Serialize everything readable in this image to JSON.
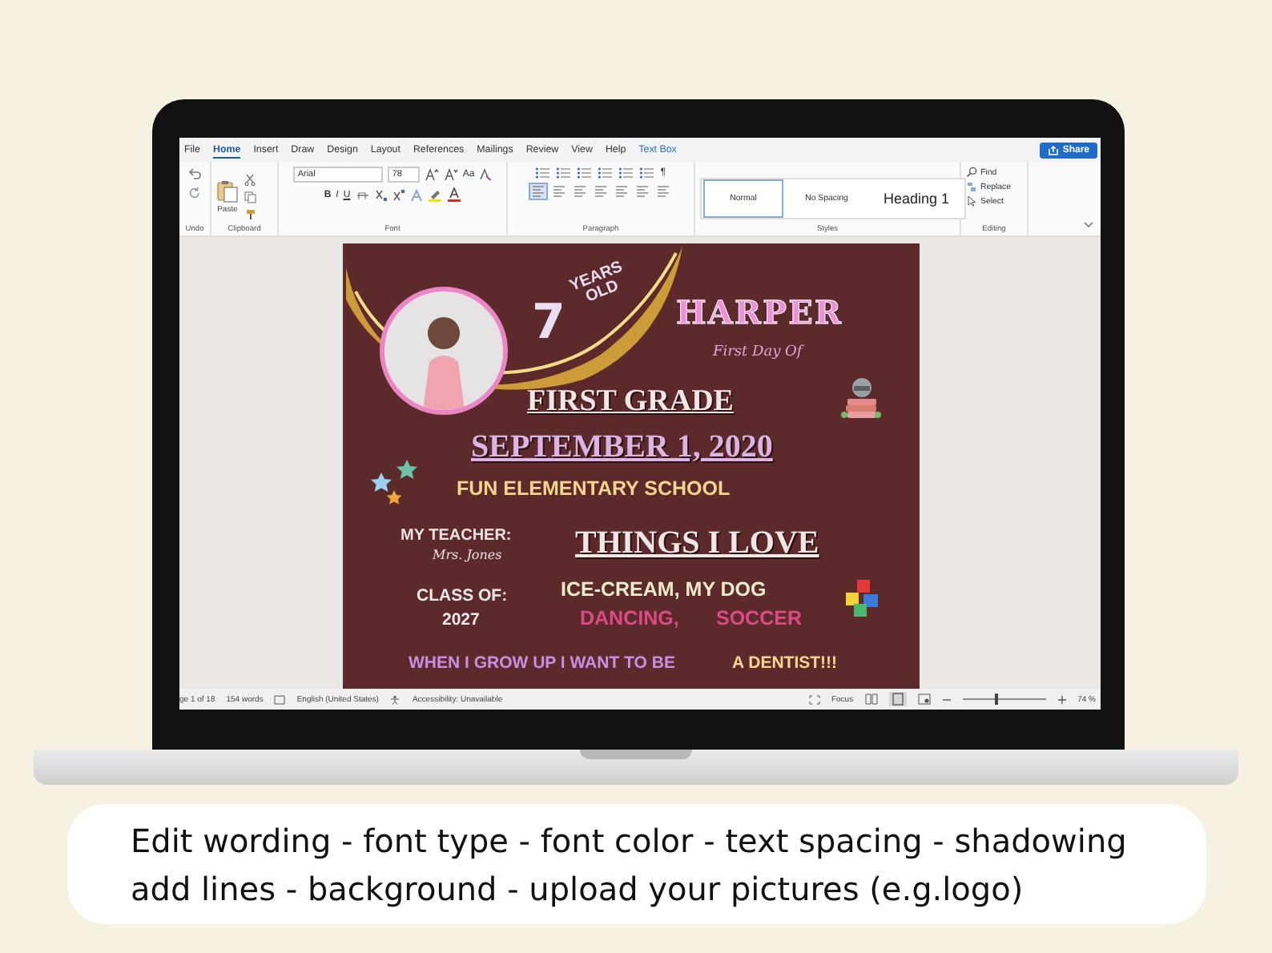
{
  "menu_tabs": [
    {
      "label": "File",
      "selected": false,
      "contextual": false
    },
    {
      "label": "Home",
      "selected": true,
      "contextual": false
    },
    {
      "label": "Insert",
      "selected": false,
      "contextual": false
    },
    {
      "label": "Draw",
      "selected": false,
      "contextual": false
    },
    {
      "label": "Design",
      "selected": false,
      "contextual": false
    },
    {
      "label": "Layout",
      "selected": false,
      "contextual": false
    },
    {
      "label": "References",
      "selected": false,
      "contextual": false
    },
    {
      "label": "Mailings",
      "selected": false,
      "contextual": false
    },
    {
      "label": "Review",
      "selected": false,
      "contextual": false
    },
    {
      "label": "View",
      "selected": false,
      "contextual": false
    },
    {
      "label": "Help",
      "selected": false,
      "contextual": false
    },
    {
      "label": "Text Box",
      "selected": false,
      "contextual": true
    }
  ],
  "share_button": "Share",
  "ribbon": {
    "undo": {
      "label": "Undo"
    },
    "clipboard": {
      "paste": "Paste",
      "label": "Clipboard"
    },
    "font": {
      "font_name": "Arial",
      "font_size": "78",
      "change_case": "Aa",
      "format_buttons": [
        "B",
        "I",
        "U"
      ],
      "label": "Font"
    },
    "paragraph": {
      "pilcrow": "¶",
      "label": "Paragraph"
    },
    "styles": {
      "items": [
        {
          "label": "Normal",
          "selected": true,
          "kind": "normal"
        },
        {
          "label": "No Spacing",
          "selected": false,
          "kind": "normal"
        },
        {
          "label": "Heading 1",
          "selected": false,
          "kind": "heading"
        }
      ],
      "label": "Styles"
    },
    "editing": {
      "find": "Find",
      "replace": "Replace",
      "select": "Select",
      "label": "Editing"
    }
  },
  "document": {
    "years_number": "7",
    "years_line_1": "YEARS",
    "years_line_2": "OLD",
    "name": "HARPER",
    "subtitle": "First Day Of",
    "grade": "FIRST GRADE",
    "date": "SEPTEMBER 1, 2020",
    "school": "FUN ELEMENTARY SCHOOL",
    "teacher_label": "MY TEACHER:",
    "teacher_name": "Mrs. Jones",
    "things_heading": "THINGS I LOVE",
    "class_label": "CLASS OF:",
    "class_year": "2027",
    "love_line_1": "ICE-CREAM, MY DOG",
    "love_item_a": "DANCING,",
    "love_item_b": "SOCCER",
    "dream_lead": "WHEN I GROW UP I WANT TO BE",
    "dream_answer": "A DENTIST!!!"
  },
  "status_bar": {
    "page": "ge 1 of 18",
    "words": "154 words",
    "language": "English (United States)",
    "accessibility": "Accessibility: Unavailable",
    "focus": "Focus",
    "zoom": {
      "level": 0.42,
      "reading": "74 %"
    }
  },
  "caption": [
    "Edit wording - font type - font color - text spacing - shadowing",
    "add lines - background -  upload your pictures (e.g.logo)"
  ]
}
